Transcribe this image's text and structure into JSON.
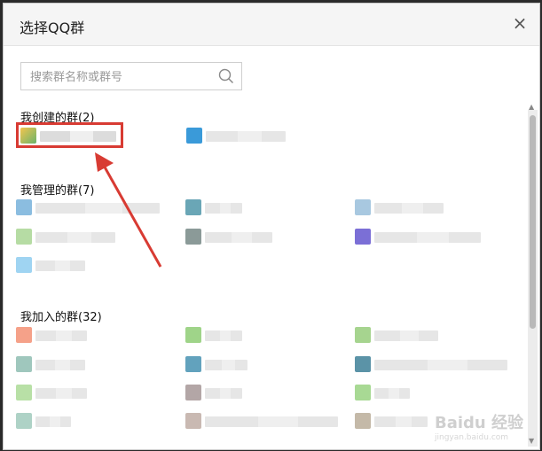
{
  "dialog": {
    "title": "选择QQ群",
    "close_glyph": "×"
  },
  "search": {
    "placeholder": "搜索群名称或群号"
  },
  "sections": {
    "created": "我创建的群(2)",
    "managed": "我管理的群(7)",
    "joined": "我加入的群(32)"
  },
  "watermark": {
    "brand": "Baidu 经验",
    "url": "jingyan.baidu.com"
  },
  "colors": {
    "highlight_box": "#d83b33",
    "annotation_arrow": "#d83b33"
  }
}
